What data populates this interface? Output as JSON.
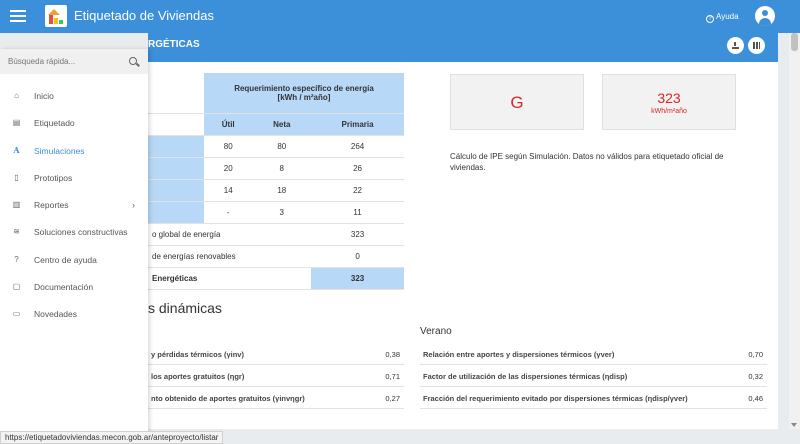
{
  "app": {
    "title": "Etiquetado de Viviendas",
    "help_label": "Ayuda"
  },
  "card": {
    "title_partial": "RGÉTICAS"
  },
  "energy_table": {
    "header_main_line1": "Requerimiento específico de energía",
    "header_main_line2": "[kWh / m²año]",
    "columns": [
      "Útil",
      "Neta",
      "Primaria"
    ],
    "rows": [
      {
        "label": "",
        "values": [
          "80",
          "80",
          "264"
        ]
      },
      {
        "label": "",
        "values": [
          "20",
          "8",
          "26"
        ]
      },
      {
        "label": "",
        "values": [
          "14",
          "18",
          "22"
        ]
      },
      {
        "label": "",
        "values": [
          "-",
          "3",
          "11"
        ]
      }
    ],
    "summary": [
      {
        "label": "o global de energía",
        "value": "323"
      },
      {
        "label": "de energías renovables",
        "value": "0"
      },
      {
        "label": "Energéticas",
        "value": "323"
      }
    ]
  },
  "result": {
    "grade": "G",
    "value": "323",
    "unit": "kWh/m²año",
    "note": "Cálculo de IPE según Simulación. Datos no válidos para etiquetado oficial de viviendas."
  },
  "dynamics": {
    "section_title": "s dinámicas",
    "winter_rows": [
      {
        "label": "y pérdidas térmicos (γinv)",
        "value": "0,38"
      },
      {
        "label": "los aportes gratuitos (ηgr)",
        "value": "0,71"
      },
      {
        "label": "nto obtenido de aportes gratuitos (γinvηgr)",
        "value": "0,27"
      }
    ],
    "summer_title": "Verano",
    "summer_rows": [
      {
        "label": "Relación entre aportes y dispersiones térmicos (γver)",
        "value": "0,70"
      },
      {
        "label": "Factor de utilización de las dispersiones térmicas (ηdisp)",
        "value": "0,32"
      },
      {
        "label": "Fracción del requerimiento evitado por dispersiones térmicas (ηdisp/γver)",
        "value": "0,46"
      }
    ]
  },
  "sidebar": {
    "search_placeholder": "Búsqueda rápida...",
    "items": [
      {
        "label": "Inicio",
        "icon": "home-icon"
      },
      {
        "label": "Etiquetado",
        "icon": "document-icon"
      },
      {
        "label": "Simulaciones",
        "icon": "font-a-icon"
      },
      {
        "label": "Prototipos",
        "icon": "file-icon"
      },
      {
        "label": "Reportes",
        "icon": "bar-chart-icon"
      },
      {
        "label": "Soluciones constructivas",
        "icon": "layers-icon"
      },
      {
        "label": "Centro de ayuda",
        "icon": "question-icon"
      },
      {
        "label": "Documentación",
        "icon": "file-text-icon"
      },
      {
        "label": "Novedades",
        "icon": "newspaper-icon"
      }
    ]
  },
  "status_bar": {
    "url": "https://etiquetadoviviendas.mecon.gob.ar/anteproyecto/listar"
  }
}
